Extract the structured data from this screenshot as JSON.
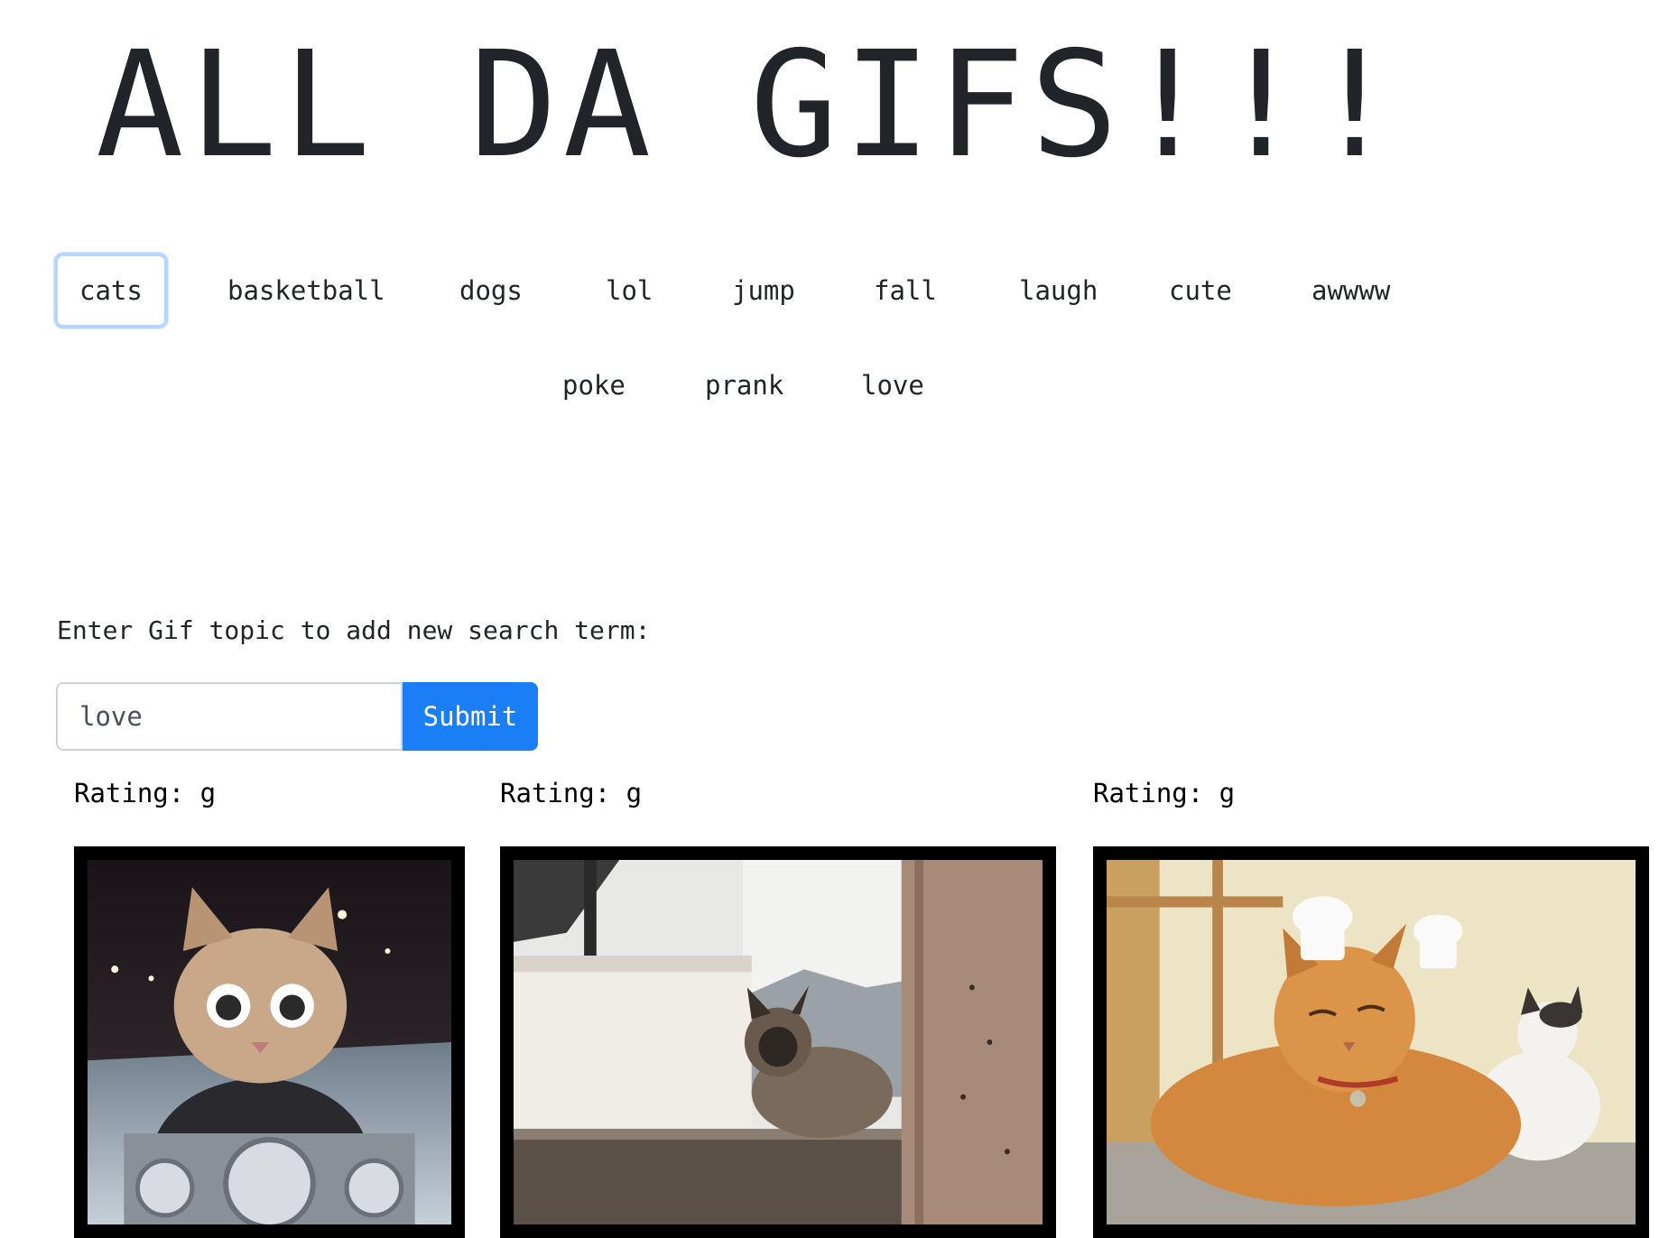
{
  "page": {
    "title": "ALL DA GIFS!!!"
  },
  "topics": [
    {
      "label": "cats",
      "active": true
    },
    {
      "label": "basketball"
    },
    {
      "label": "dogs"
    },
    {
      "label": "lol"
    },
    {
      "label": "jump"
    },
    {
      "label": "fall"
    },
    {
      "label": "laugh"
    },
    {
      "label": "cute"
    },
    {
      "label": "awwww"
    },
    {
      "label": "poke"
    },
    {
      "label": "prank"
    },
    {
      "label": "love"
    }
  ],
  "form": {
    "prompt": "Enter Gif topic to add new search term:",
    "input_value": "love",
    "submit_label": "Submit"
  },
  "gifs": [
    {
      "rating_text": "Rating: g",
      "subject": "kitten riding motorcycle"
    },
    {
      "rating_text": "Rating: g",
      "subject": "siamese cat on windowsill"
    },
    {
      "rating_text": "Rating: g",
      "subject": "orange cat wearing chef hat"
    }
  ],
  "colors": {
    "primary": "#1a7ff6",
    "focus_ring": "#b6d7fb",
    "text": "#212529",
    "frame": "#000000"
  }
}
